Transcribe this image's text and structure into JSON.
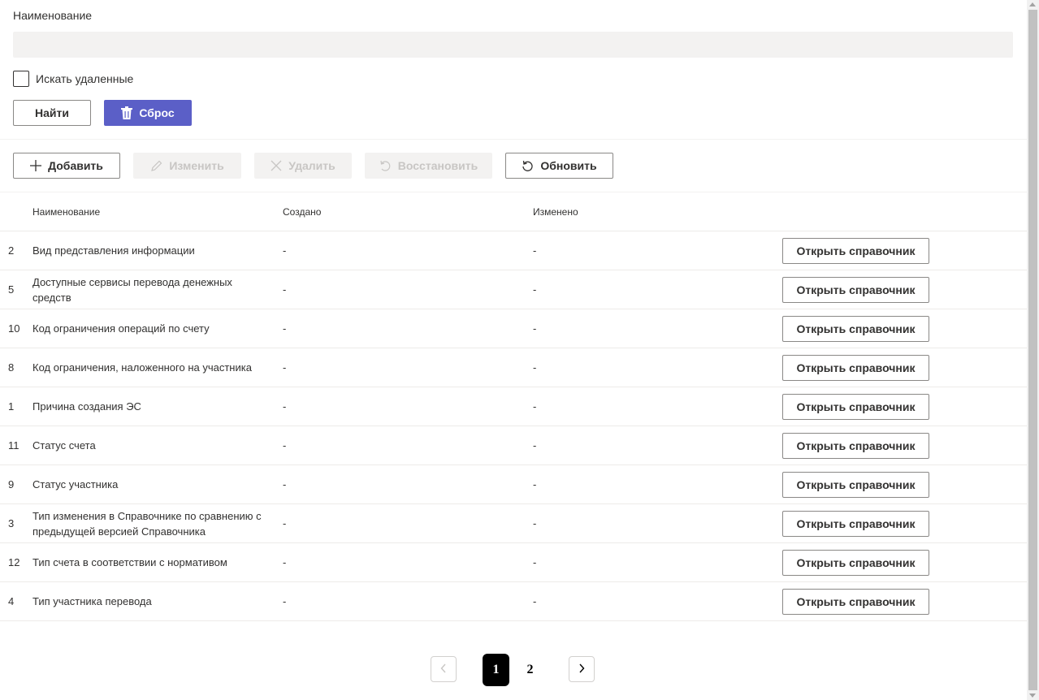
{
  "filter": {
    "name_label": "Наименование",
    "name_value": "",
    "name_placeholder": "",
    "search_deleted_label": "Искать удаленные",
    "find_button": "Найти",
    "reset_button": "Сброс"
  },
  "toolbar": {
    "add": "Добавить",
    "edit": "Изменить",
    "delete": "Удалить",
    "restore": "Восстановить",
    "refresh": "Обновить"
  },
  "table": {
    "columns": [
      "Наименование",
      "Создано",
      "Изменено"
    ],
    "open_button": "Открыть справочник",
    "rows": [
      {
        "id": "2",
        "name": "Вид представления информации",
        "created": "-",
        "changed": "-"
      },
      {
        "id": "5",
        "name": "Доступные сервисы перевода денежных средств",
        "created": "-",
        "changed": "-"
      },
      {
        "id": "10",
        "name": "Код ограничения операций по счету",
        "created": "-",
        "changed": "-"
      },
      {
        "id": "8",
        "name": "Код ограничения, наложенного на участника",
        "created": "-",
        "changed": "-"
      },
      {
        "id": "1",
        "name": "Причина создания ЭС",
        "created": "-",
        "changed": "-"
      },
      {
        "id": "11",
        "name": "Статус счета",
        "created": "-",
        "changed": "-"
      },
      {
        "id": "9",
        "name": "Статус участника",
        "created": "-",
        "changed": "-"
      },
      {
        "id": "3",
        "name": "Тип изменения в Справочнике по сравнению с предыдущей версией Справочника",
        "created": "-",
        "changed": "-"
      },
      {
        "id": "12",
        "name": "Тип счета в соответствии с нормативом",
        "created": "-",
        "changed": "-"
      },
      {
        "id": "4",
        "name": "Тип участника перевода",
        "created": "-",
        "changed": "-"
      }
    ]
  },
  "pagination": {
    "pages": [
      "1",
      "2"
    ],
    "current": "1"
  },
  "colors": {
    "primary": "#5b5fc7",
    "input_bg": "#f3f2f1",
    "disabled_text": "#c8c6c4"
  }
}
